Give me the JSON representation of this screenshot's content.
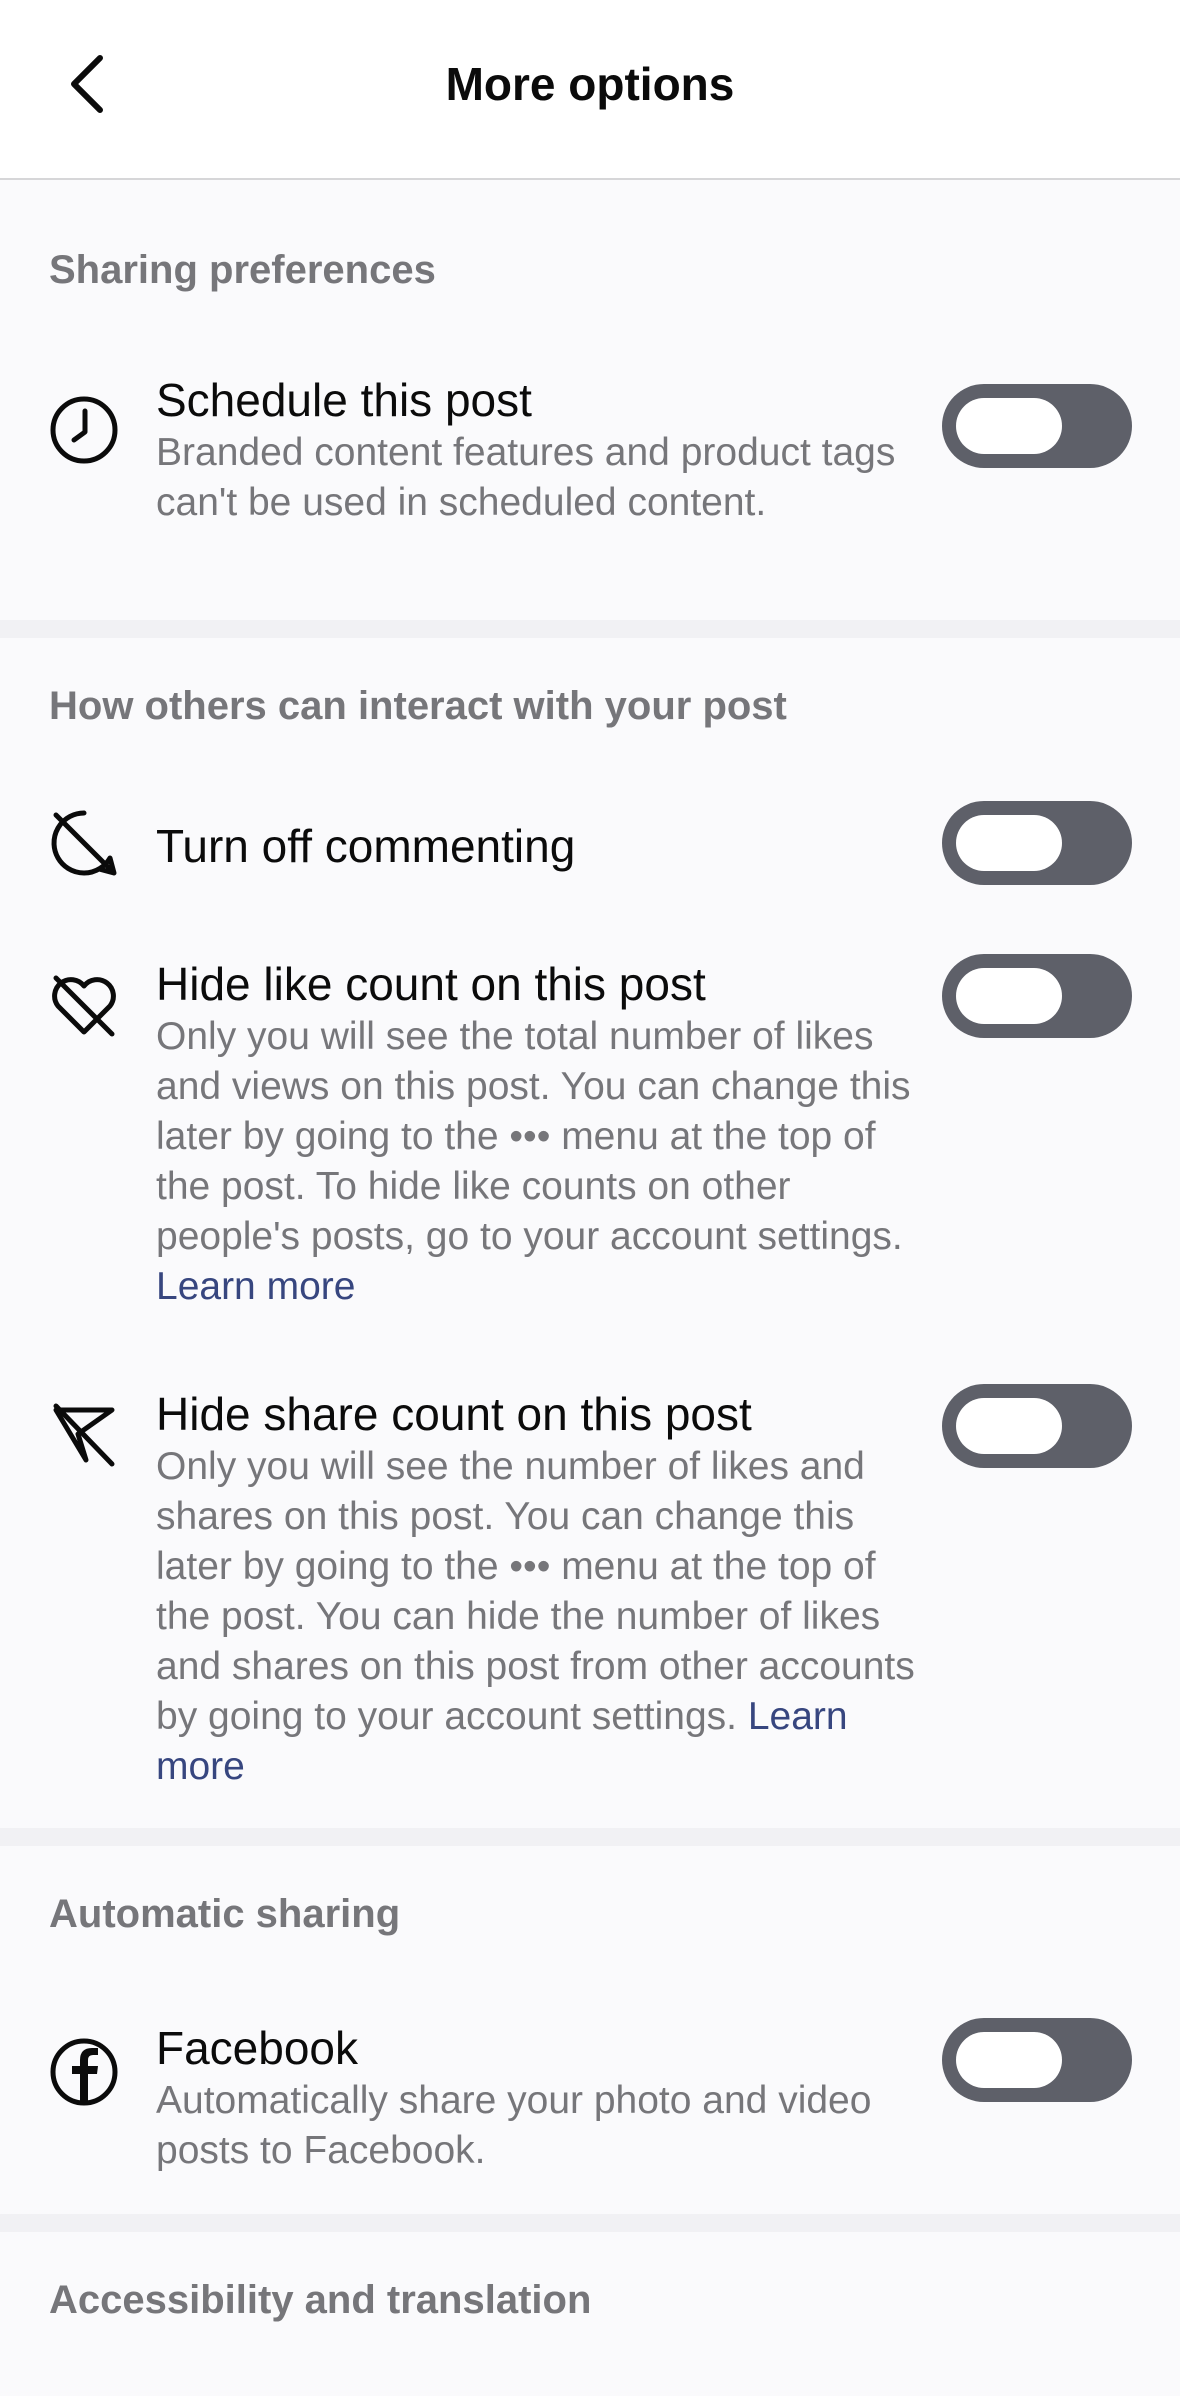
{
  "header": {
    "title": "More options",
    "back_icon": "chevron-left-icon"
  },
  "sections": {
    "sharing": {
      "title": "Sharing preferences",
      "schedule": {
        "icon": "clock-icon",
        "label": "Schedule this post",
        "desc": "Branded content features and product tags can't be used in scheduled content.",
        "enabled": false
      }
    },
    "interact": {
      "title": "How others can interact with your post",
      "commenting": {
        "icon": "comment-off-icon",
        "label": "Turn off commenting",
        "enabled": false
      },
      "hide_likes": {
        "icon": "heart-off-icon",
        "label": "Hide like count on this post",
        "desc": "Only you will see the total number of likes and views on this post. You can change this later by going to the ••• menu at the top of the post. To hide like counts on other people's posts, go to your account settings. ",
        "link": "Learn more",
        "enabled": false
      },
      "hide_shares": {
        "icon": "share-off-icon",
        "label": "Hide share count on this post",
        "desc": "Only you will see the number of likes and shares on this post. You can change this later by going to the ••• menu at the top of the post. You can hide the number of likes and shares on this post from other accounts by going to your account settings. ",
        "link": "Learn more",
        "enabled": false
      }
    },
    "auto_sharing": {
      "title": "Automatic sharing",
      "facebook": {
        "icon": "facebook-icon",
        "label": "Facebook",
        "desc": "Automatically share your photo and video posts to Facebook.",
        "enabled": false
      }
    },
    "accessibility": {
      "title": "Accessibility and translation"
    }
  },
  "colors": {
    "toggle_off": "#5e6069",
    "secondary_text": "#76767a",
    "link": "#37467f",
    "background": "#fafafc"
  }
}
